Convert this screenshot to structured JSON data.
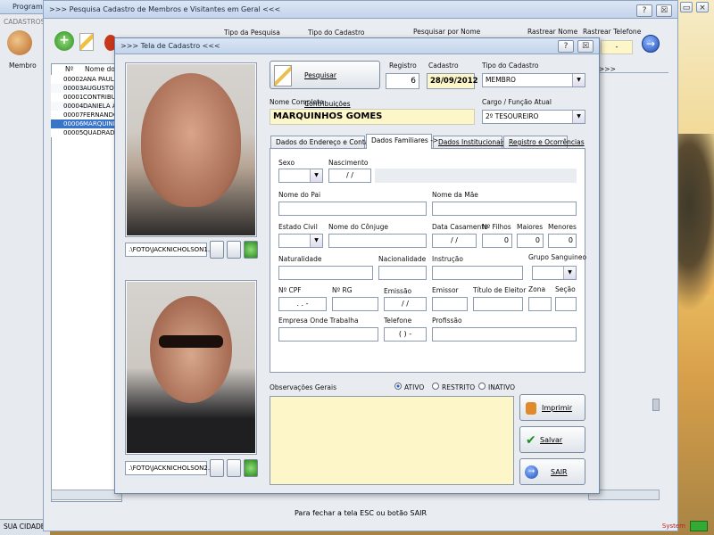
{
  "app": {
    "title": "Programa",
    "cadastros_label": "CADASTROS",
    "membro_label": "Membro",
    "status_left": "SUA CIDADE -",
    "status_right": "System"
  },
  "search_window": {
    "title": ">>> Pesquisa Cadastro de Membros e Visitantes em Geral <<<",
    "help_btn": "?",
    "close_btn": "☒",
    "col_tipo_pesquisa": "Tipo da Pesquisa",
    "col_tipo_cadastro": "Tipo do Cadastro",
    "col_pesquisar_nome": "Pesquisar por Nome",
    "col_rastrear_nome": "Rastrear Nome",
    "col_rastrear_telefone": "Rastrear Telefone",
    "telefone_value": "-",
    "grid_header_n": "Nº",
    "grid_header_nome": "Nome do Me",
    "grid_arrows": ">>>",
    "footer_hint": "Para fechar a tela ESC ou botão SAIR",
    "rows": [
      {
        "n": "00002",
        "nome": "ANA PAULA"
      },
      {
        "n": "00003",
        "nome": "AUGUSTO"
      },
      {
        "n": "00001",
        "nome": "CONTRIBUI"
      },
      {
        "n": "00004",
        "nome": "DANIELA AF"
      },
      {
        "n": "00007",
        "nome": "FERNANDO"
      },
      {
        "n": "00006",
        "nome": "MARQUINH"
      },
      {
        "n": "00005",
        "nome": "QUADRADO"
      }
    ]
  },
  "dialog": {
    "title": ">>> Tela de Cadastro <<<",
    "help_btn": "?",
    "close_btn": "☒",
    "photo1_path": ".\\FOTO\\JACKNICHOLSON1.JF",
    "photo2_path": ".\\FOTO\\JACKNICHOLSON2.JF",
    "pesquisar_contribuicoes": "Pesquisar Contribuições",
    "registro_label": "Registro",
    "registro_value": "6",
    "cadastro_label": "Cadastro",
    "cadastro_value": "28/09/2012",
    "tipo_cadastro_label": "Tipo do Cadastro",
    "tipo_cadastro_value": "MEMBRO",
    "nome_completo_label": "Nome Completo",
    "nome_completo_value": "MARQUINHOS GOMES",
    "cargo_label": "Cargo / Função Atual",
    "cargo_value": "2º TESOUREIRO",
    "tabs": [
      {
        "label": "Dados do Endereço e Contato ->"
      },
      {
        "label": "Dados Familiares ->"
      },
      {
        "label": "Dados Institucionais ->"
      },
      {
        "label": "Registro e Ocorrências"
      }
    ],
    "form": {
      "sexo": "Sexo",
      "nascimento": "Nascimento",
      "nascimento_value": "/ /",
      "nome_pai": "Nome do Pai",
      "nome_mae": "Nome da Mãe",
      "estado_civil": "Estado Civil",
      "nome_conjuge": "Nome do Cônjuge",
      "data_casamento": "Data Casamento",
      "data_casamento_value": "/ /",
      "n_filhos": "Nº Filhos",
      "n_filhos_value": "0",
      "maiores": "Maiores",
      "maiores_value": "0",
      "menores": "Menores",
      "menores_value": "0",
      "naturalidade": "Naturalidade",
      "nacionalidade": "Nacionalidade",
      "instrucao": "Instrução",
      "grupo_sanguineo": "Grupo Sanguineo",
      "cpf": "Nº CPF",
      "cpf_value": ". . -",
      "rg": "Nº RG",
      "emissao": "Emissão",
      "emissao_value": "/ /",
      "emissor": "Emissor",
      "titulo_eleitor": "Título de Eleitor",
      "zona": "Zona",
      "secao": "Seção",
      "empresa": "Empresa Onde Trabalha",
      "telefone": "Telefone",
      "telefone_value": "( ) -",
      "profissao": "Profissão"
    },
    "observacoes_label": "Observações Gerais",
    "status_options": [
      {
        "label": "ATIVO",
        "selected": true
      },
      {
        "label": "RESTRITO",
        "selected": false
      },
      {
        "label": "INATIVO",
        "selected": false
      }
    ],
    "imprimir_label": "Imprimir Ficha",
    "salvar_label": "Salvar Cadastro",
    "sair_label": "SAIR",
    "colors": {
      "highlight_field": "#fdf6c8",
      "accent_blue": "#2a67c9"
    }
  }
}
